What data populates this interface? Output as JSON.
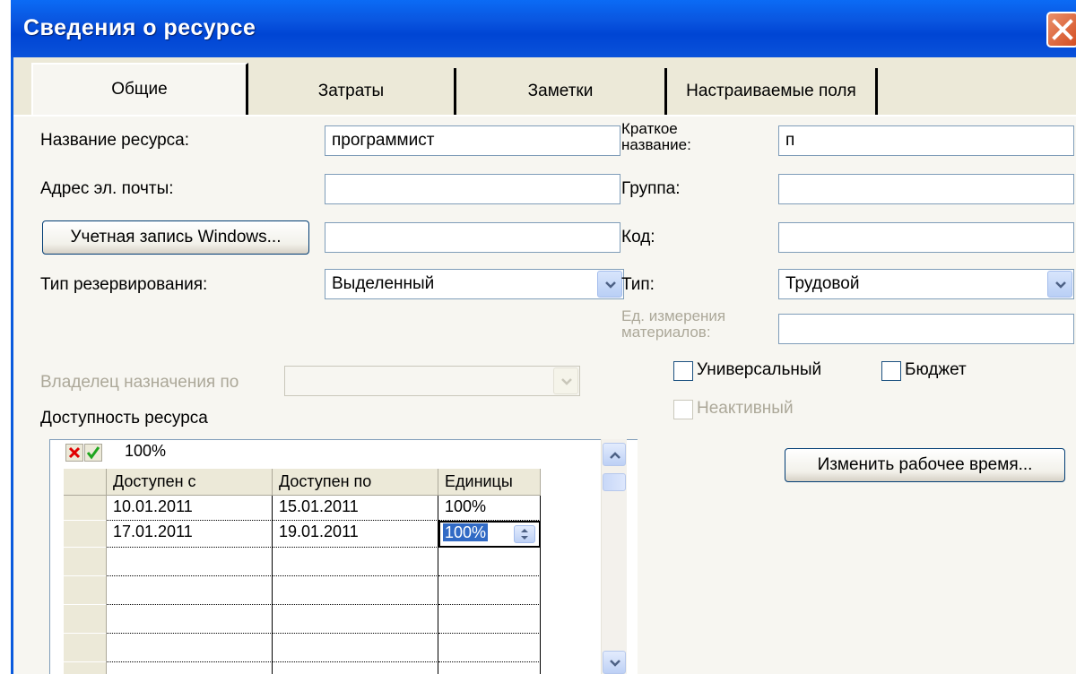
{
  "window": {
    "title": "Сведения о ресурсе"
  },
  "tabs": [
    {
      "label": "Общие"
    },
    {
      "label": "Затраты"
    },
    {
      "label": "Заметки"
    },
    {
      "label": "Настраиваемые поля"
    }
  ],
  "form": {
    "resource_name_label": "Название ресурса:",
    "resource_name_value": "программист",
    "email_label": "Адрес эл. почты:",
    "email_value": "",
    "windows_account_button": "Учетная запись Windows...",
    "windows_account_value": "",
    "booking_type_label": "Тип резервирования:",
    "booking_type_value": "Выделенный",
    "assignment_owner_label": "Владелец назначения по",
    "assignment_owner_value": "",
    "availability_label": "Доступность ресурса",
    "short_name_label_line1": "Краткое",
    "short_name_label_line2": "название:",
    "short_name_value": "п",
    "group_label": "Группа:",
    "group_value": "",
    "code_label": "Код:",
    "code_value": "",
    "type_label": "Тип:",
    "type_value": "Трудовой",
    "material_unit_label_line1": "Ед. измерения",
    "material_unit_label_line2": "материалов:",
    "material_unit_value": "",
    "generic_label": "Универсальный",
    "generic_checked": false,
    "budget_label": "Бюджет",
    "budget_checked": false,
    "inactive_label": "Неактивный",
    "inactive_checked": false,
    "change_working_time_button": "Изменить рабочее время..."
  },
  "availability_grid": {
    "edit_value": "100%",
    "columns": [
      "Доступен с",
      "Доступен по",
      "Единицы"
    ],
    "rows": [
      [
        "10.01.2011",
        "15.01.2011",
        "100%"
      ],
      [
        "17.01.2011",
        "19.01.2011",
        "100%"
      ],
      [
        "",
        "",
        ""
      ],
      [
        "",
        "",
        ""
      ],
      [
        "",
        "",
        ""
      ],
      [
        "",
        "",
        ""
      ]
    ]
  },
  "colors": {
    "title_bar": "#0A5BDE",
    "dialog_bg": "#ECE9D8",
    "close_button": "#D44D22"
  }
}
